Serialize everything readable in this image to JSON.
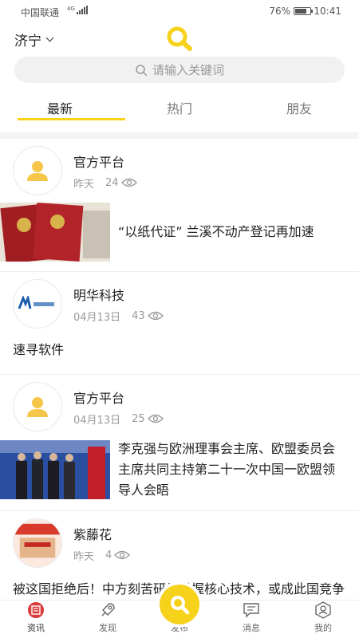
{
  "status_bar": {
    "carrier": "中国联通",
    "network": "4G",
    "battery": "76%",
    "battery_level": 0.76,
    "time": "10:41"
  },
  "header": {
    "city": "济宁"
  },
  "search": {
    "placeholder": "请输入关键词"
  },
  "tabs": [
    {
      "label": "最新",
      "active": true
    },
    {
      "label": "热门",
      "active": false
    },
    {
      "label": "朋友",
      "active": false
    }
  ],
  "posts": [
    {
      "author": "官方平台",
      "date": "昨天",
      "views": "24",
      "title": "“以纸代证” 兰溪不动产登记再加速"
    },
    {
      "author": "明华科技",
      "date": "04月13日",
      "views": "43",
      "text": "速寻软件"
    },
    {
      "author": "官方平台",
      "date": "04月13日",
      "views": "25",
      "title": "李克强与欧洲理事会主席、欧盟委员会主席共同主持第二十一次中国一欧盟领导人会晤"
    },
    {
      "author": "紫藤花",
      "date": "昨天",
      "views": "4",
      "text": "被这国拒绝后！中方刻苦研发掌握核心技术，或成此国竞争对手！"
    }
  ],
  "bottom_nav": [
    {
      "label": "资讯",
      "icon": "news-icon",
      "active": true
    },
    {
      "label": "发现",
      "icon": "rocket-icon",
      "active": false
    },
    {
      "label": "发布",
      "icon": "search-publish-icon",
      "active": false
    },
    {
      "label": "消息",
      "icon": "message-icon",
      "active": false
    },
    {
      "label": "我的",
      "icon": "profile-icon",
      "active": false
    }
  ],
  "colors": {
    "accent": "#f6d21b",
    "text": "#222222",
    "muted": "#999999"
  }
}
